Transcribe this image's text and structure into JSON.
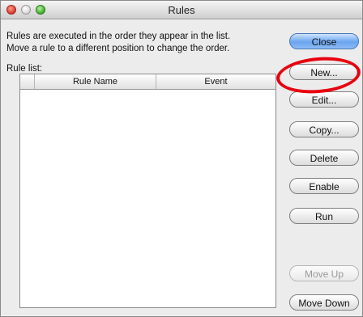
{
  "window": {
    "title": "Rules"
  },
  "instructions": {
    "line1": "Rules are executed in the order they appear in the list.",
    "line2": "Move a rule to a different position to change the order."
  },
  "rule_list": {
    "label": "Rule list:",
    "columns": [
      "",
      "Rule Name",
      "Event"
    ],
    "rows": []
  },
  "buttons": {
    "close": "Close",
    "new": "New...",
    "edit": "Edit...",
    "copy": "Copy...",
    "delete": "Delete",
    "enable": "Enable",
    "run": "Run",
    "move_up": "Move Up",
    "move_down": "Move Down"
  },
  "colors": {
    "highlight_ring": "#e8000f",
    "primary_button": "#6aa5ef"
  }
}
